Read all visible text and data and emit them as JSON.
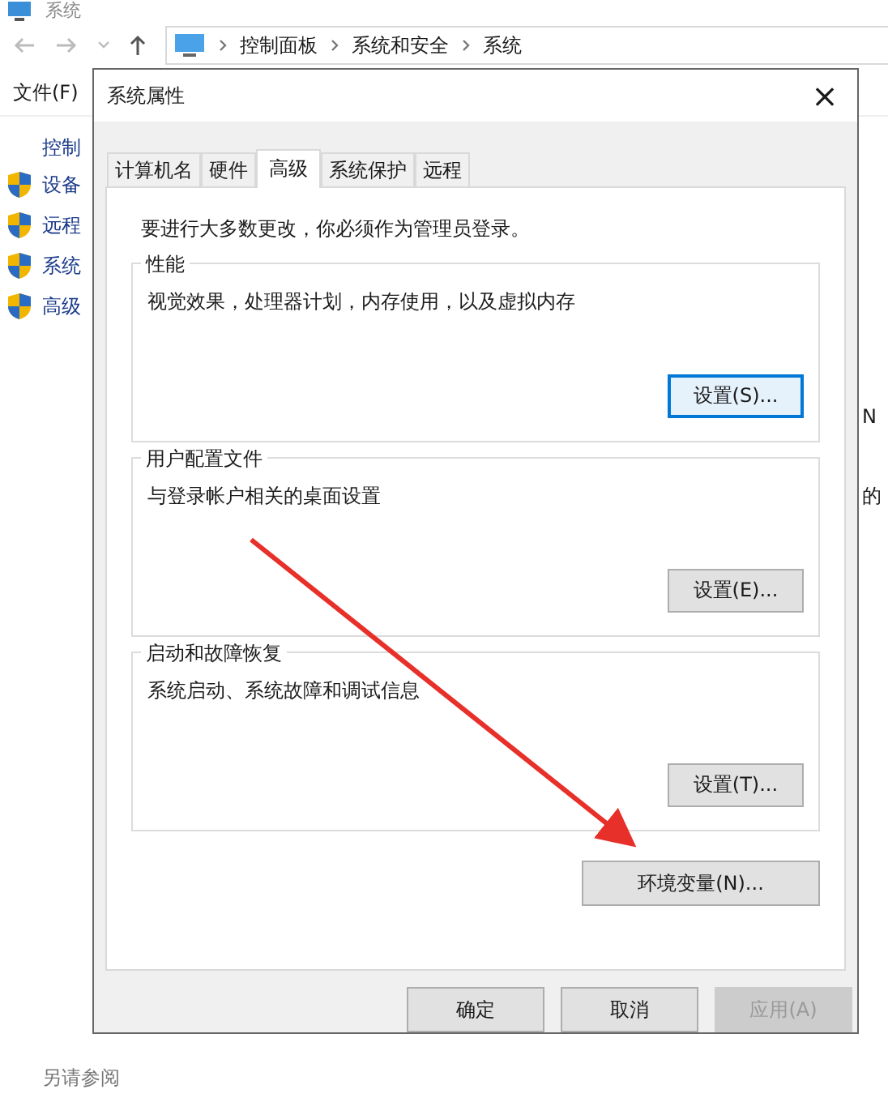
{
  "background_window": {
    "title": "系统",
    "breadcrumbs": [
      "控制面板",
      "系统和安全",
      "系统"
    ],
    "menu": [
      "文件(F)"
    ],
    "sidebar_heading": "控制",
    "sidebar_items": [
      "设备",
      "远程",
      "系统",
      "高级"
    ],
    "content_fragments": [
      "N",
      "的"
    ],
    "see_also": "另请参阅"
  },
  "dialog": {
    "title": "系统属性",
    "close": "×",
    "tabs": [
      {
        "label": "计算机名",
        "selected": false
      },
      {
        "label": "硬件",
        "selected": false
      },
      {
        "label": "高级",
        "selected": true
      },
      {
        "label": "系统保护",
        "selected": false
      },
      {
        "label": "远程",
        "selected": false
      }
    ],
    "notice": "要进行大多数更改，你必须作为管理员登录。",
    "groups": [
      {
        "title": "性能",
        "description": "视觉效果，处理器计划，内存使用，以及虚拟内存",
        "button": "设置(S)...",
        "focused": true
      },
      {
        "title": "用户配置文件",
        "description": "与登录帐户相关的桌面设置",
        "button": "设置(E)...",
        "focused": false
      },
      {
        "title": "启动和故障恢复",
        "description": "系统启动、系统故障和调试信息",
        "button": "设置(T)...",
        "focused": false
      }
    ],
    "env_button": "环境变量(N)...",
    "buttons": [
      {
        "label": "确定",
        "disabled": false
      },
      {
        "label": "取消",
        "disabled": false
      },
      {
        "label": "应用(A)",
        "disabled": true
      }
    ]
  }
}
